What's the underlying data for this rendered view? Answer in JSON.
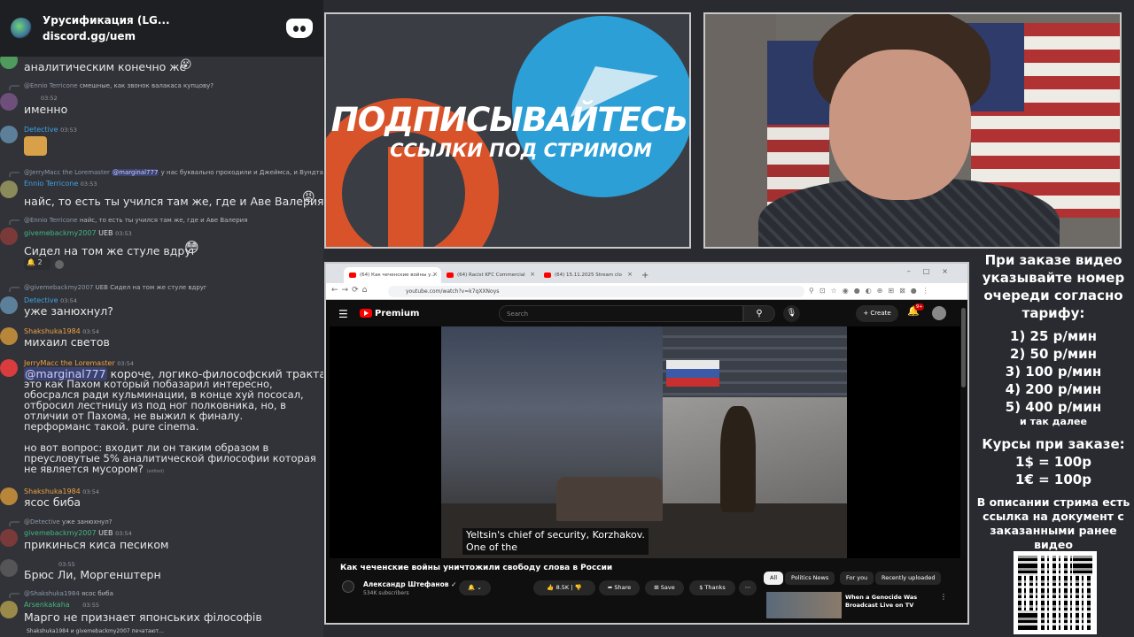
{
  "chat": {
    "server_name": "Урусификация (LG...",
    "invite_link": "discord.gg/uem",
    "messages": [
      {
        "text": "аналитическим конечно же"
      },
      {
        "reply_user": "@Ennio Terricone",
        "reply_text": "смешные, как звонок валакаса купцову?",
        "time": "03:52",
        "text": "именно"
      },
      {
        "user": "Detective",
        "time": "03:53"
      },
      {
        "reply_user": "@JerryMacc the Loremaster",
        "reply_mention": "@marginal777",
        "reply_text": "у нас буквально проходили и Джеймса, и Вундта, и Ф",
        "user": "Ennio Terricone",
        "time": "03:53",
        "text": "найс, то есть ты учился там же, где и Аве Валерия"
      },
      {
        "reply_user": "@Ennio Terricone",
        "reply_text": "найс, то есть ты учился там же, где и Аве Валерия",
        "user": "givemebackmy2007",
        "badge": "UEB",
        "time": "03:53",
        "text": "Сидел на том же стуле вдруг",
        "reaction_count": "2"
      },
      {
        "reply_user": "@givemebackmy2007",
        "reply_badge": "UEB",
        "reply_text": "Сидел на том же стуле вдруг",
        "user": "Detective",
        "time": "03:54",
        "text": "уже занюхнул?"
      },
      {
        "user": "Shakshuka1984",
        "time": "03:54",
        "text": "михаил светов"
      },
      {
        "user": "JerryMacc the Loremaster",
        "time": "03:54",
        "mention": "@marginal777",
        "lines": [
          "короче, логико-философский трактат -",
          "это как Пахом который побазарил интересно,",
          "обосрался ради кульминации, в конце хуй пососал,",
          "отбросил лестницу из под ног полковника, но, в",
          "отличии от Пахома, не выжил к финалу.",
          "перформанс такой. pure cinema."
        ],
        "lines2": [
          "но вот вопрос: входит ли он таким образом в",
          "преусловутые 5% аналитической философии которая",
          "не является мусором?"
        ],
        "edited": "(edited)"
      },
      {
        "user": "Shakshuka1984",
        "time": "03:54",
        "text": "ясос биба"
      },
      {
        "reply_user": "@Detective",
        "reply_text": "уже занюхнул?",
        "user": "givemebackmy2007",
        "badge": "UEB",
        "time": "03:54",
        "text": "прикинься киса песиком"
      },
      {
        "time": "03:55",
        "text": "Брюс Ли, Моргенштерн"
      },
      {
        "reply_user": "@Shakshuka1984",
        "reply_text": "ясос биба",
        "user": "Arsenkakaha",
        "time": "03:55",
        "text": "Марго не признает японських філософів"
      }
    ],
    "typing": "Shakshuka1984 и givemebackmy2007 печатают..."
  },
  "stream_banner": {
    "title": "ПОДПИСЫВАЙТЕСЬ",
    "subtitle": "ССЫЛКИ ПОД СТРИМОМ"
  },
  "browser": {
    "tabs": [
      {
        "label": "(64) Как чеченские войны у..."
      },
      {
        "label": "(64) Racist KFC Commercial"
      },
      {
        "label": "(64) 15.11.2025 Stream clo"
      }
    ],
    "url": "youtube.com/watch?v=k7qXXNoys",
    "youtube": {
      "brand": "Premium",
      "search_placeholder": "Search",
      "create_label": "Create",
      "notif_count": "9+",
      "caption_line1": "Yeltsin's chief of security, Korzhakov.",
      "caption_line2": "One of the",
      "video_title": "Как чеченские войны уничтожили свободу слова в России",
      "channel_name": "Александр Штефанов",
      "subscribers": "534K subscribers",
      "likes": "8.5K",
      "share_label": "Share",
      "save_label": "Save",
      "thanks_label": "Thanks",
      "chips": [
        "All",
        "Politics News",
        "For you",
        "Recently uploaded"
      ],
      "rec_title_1": "When a Genocide Was",
      "rec_title_2": "Broadcast Live on TV"
    }
  },
  "info": {
    "heading": "При заказе видео указывайте номер очереди согласно тарифу:",
    "prices": [
      "1) 25 р/мин",
      "2) 50 р/мин",
      "3) 100 р/мин",
      "4) 200 р/мин",
      "5) 400 р/мин"
    ],
    "etc": "и так далее",
    "rates_heading": "Курсы при заказе:",
    "rates": [
      "1$ = 100р",
      "1€ = 100р"
    ],
    "description": "В описании стрима есть ссылка на документ с заказанными ранее видео"
  }
}
